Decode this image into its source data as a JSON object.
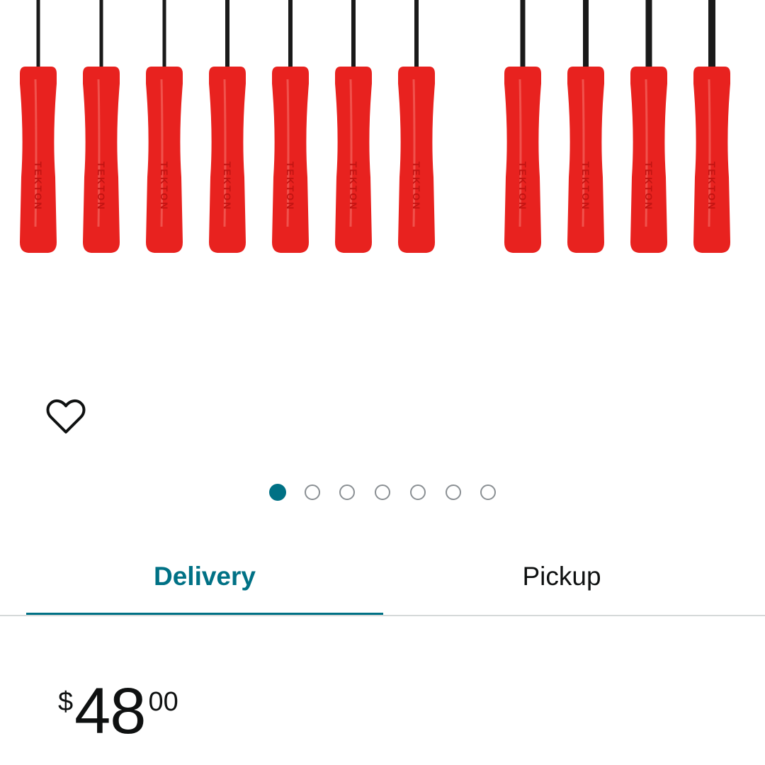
{
  "product": {
    "brand_on_handles": "TEKTON",
    "handle_color": "#e8221f",
    "shaft_color": "#1a1a1a",
    "screwdriver_count": 11
  },
  "gallery": {
    "image_count": 7,
    "active_index": 0,
    "wishlist_icon": "heart-outline-icon"
  },
  "tabs": {
    "delivery_label": "Delivery",
    "pickup_label": "Pickup",
    "active": "Delivery"
  },
  "price": {
    "currency_symbol": "$",
    "whole": "48",
    "fraction": "00"
  },
  "colors": {
    "accent": "#007185",
    "text": "#0f1111",
    "divider": "#d5d9d9",
    "dot_inactive_border": "#8a8f93"
  }
}
